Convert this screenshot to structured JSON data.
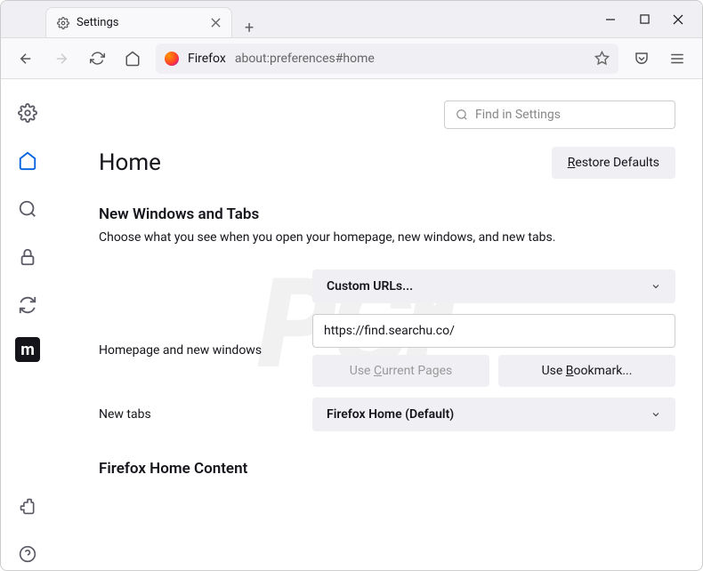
{
  "tab": {
    "title": "Settings"
  },
  "urlbar": {
    "browser_label": "Firefox",
    "url": "about:preferences#home"
  },
  "sidebar": {
    "items": [
      {
        "name": "gear"
      },
      {
        "name": "home"
      },
      {
        "name": "search"
      },
      {
        "name": "lock"
      },
      {
        "name": "sync"
      },
      {
        "name": "m"
      },
      {
        "name": "extensions"
      },
      {
        "name": "help"
      }
    ]
  },
  "search": {
    "placeholder": "Find in Settings"
  },
  "page": {
    "title": "Home",
    "restore_label": "Restore Defaults",
    "section1_title": "New Windows and Tabs",
    "section1_desc": "Choose what you see when you open your homepage, new windows, and new tabs.",
    "homepage_label": "Homepage and new windows",
    "homepage_select": "Custom URLs...",
    "homepage_url": "https://find.searchu.co/",
    "use_current_label": "Use Current Pages",
    "use_bookmark_label": "Use Bookmark...",
    "newtabs_label": "New tabs",
    "newtabs_select": "Firefox Home (Default)",
    "section2_title": "Firefox Home Content"
  }
}
